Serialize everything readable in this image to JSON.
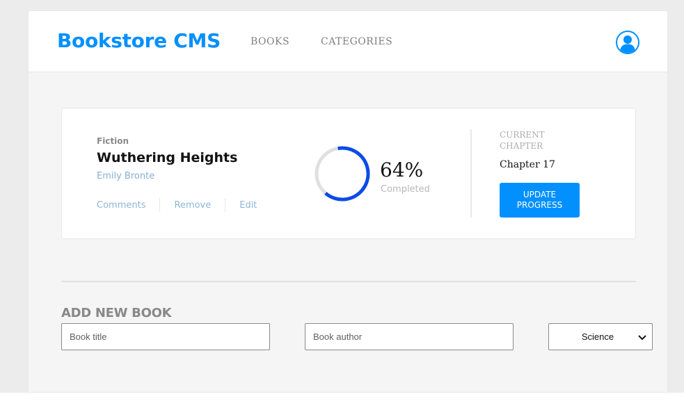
{
  "header": {
    "logo": "Bookstore CMS",
    "nav": [
      {
        "label": "BOOKS"
      },
      {
        "label": "CATEGORIES"
      }
    ],
    "avatar_icon": "user-icon"
  },
  "book": {
    "genre": "Fiction",
    "title": "Wuthering Heights",
    "author": "Emily Bronte",
    "actions": [
      {
        "label": "Comments"
      },
      {
        "label": "Remove"
      },
      {
        "label": "Edit"
      }
    ],
    "progress_percent": 64,
    "progress_label": "64%",
    "completed_label": "Completed",
    "current_chapter_label": "CURRENT CHAPTER",
    "current_chapter": "Chapter 17",
    "update_button": "UPDATE PROGRESS"
  },
  "add_book": {
    "heading": "ADD NEW BOOK",
    "title_placeholder": "Book title",
    "author_placeholder": "Book author",
    "category_selected": "Science"
  },
  "colors": {
    "brand": "#0290ff",
    "progress": "#0a4ae8",
    "progress_track": "#e0e0e0",
    "page_bg": "#f6f5f5"
  }
}
